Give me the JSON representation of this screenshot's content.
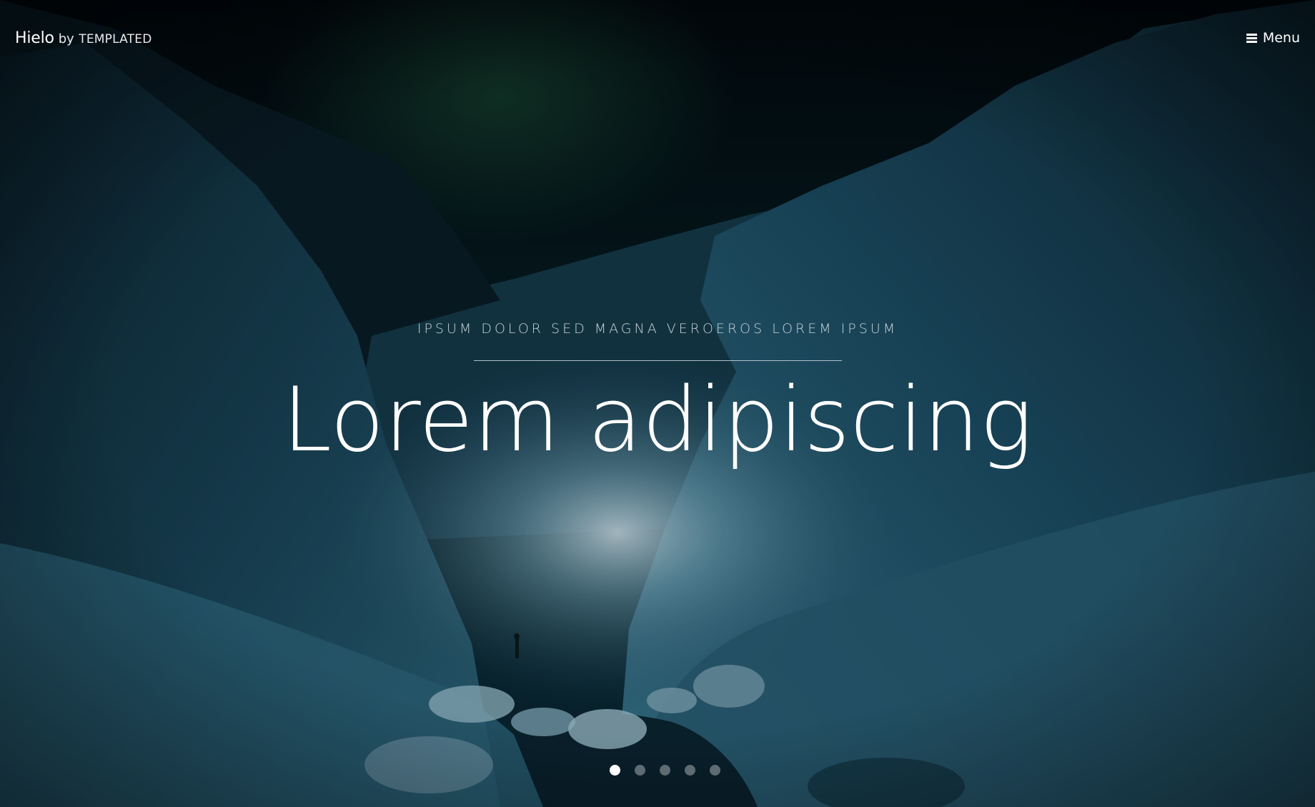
{
  "header": {
    "logo_name": "Hielo",
    "logo_by": "by",
    "logo_brand": "TEMPLATED",
    "menu_label": "Menu",
    "menu_icon": "hamburger-icon"
  },
  "banner": {
    "subtitle": "IPSUM DOLOR SED MAGNA VEROEROS LOREM IPSUM",
    "title": "Lorem adipiscing"
  },
  "slider": {
    "slide_count": 5,
    "active_index": 0
  },
  "colors": {
    "text": "#ffffff",
    "subtitle": "#c8d2d8",
    "background": "#05121a",
    "dot_inactive": "rgba(255,255,255,0.35)",
    "dot_active": "#ffffff"
  }
}
